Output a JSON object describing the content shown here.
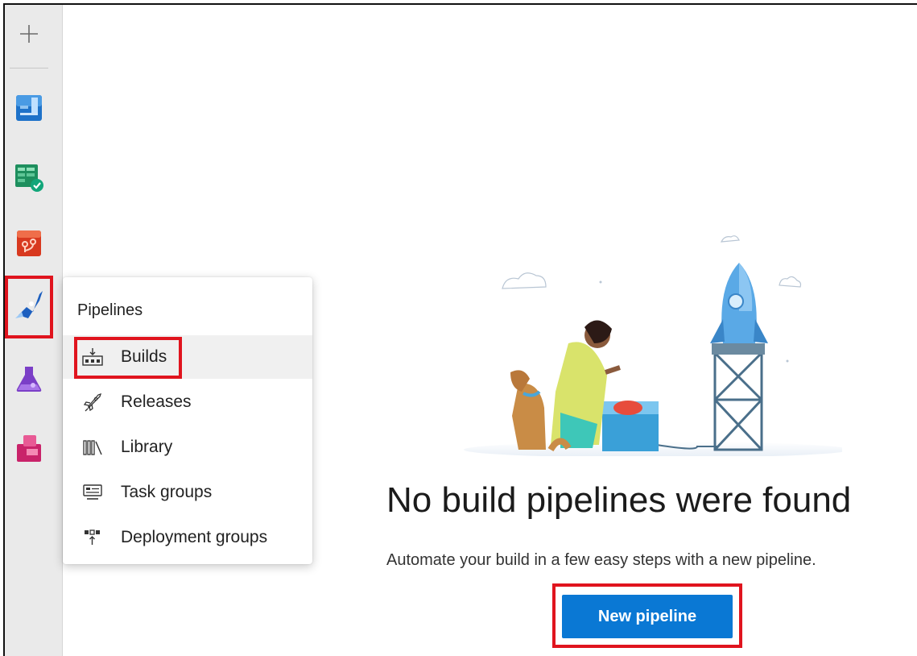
{
  "flyout": {
    "title": "Pipelines",
    "items": [
      {
        "label": "Builds",
        "icon": "builds-icon",
        "selected": true
      },
      {
        "label": "Releases",
        "icon": "rocket-icon"
      },
      {
        "label": "Library",
        "icon": "library-icon"
      },
      {
        "label": "Task groups",
        "icon": "task-groups-icon"
      },
      {
        "label": "Deployment groups",
        "icon": "deployment-groups-icon"
      }
    ]
  },
  "leftnav": {
    "icons": [
      "add-icon",
      "boards-icon",
      "test-plans-icon",
      "repos-icon",
      "pipelines-icon",
      "test-icon",
      "artifacts-icon"
    ]
  },
  "empty_state": {
    "headline": "No build pipelines were found",
    "subline": "Automate your build in a few easy steps with a new pipeline.",
    "button": "New pipeline"
  },
  "colors": {
    "primary": "#0a78d4",
    "highlight": "#e0141e",
    "sidebar": "#eaeaea"
  }
}
